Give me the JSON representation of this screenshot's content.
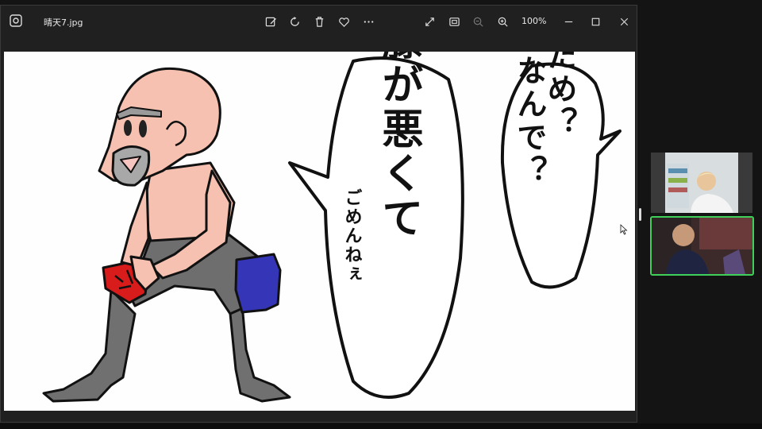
{
  "window": {
    "filename": "晴天7.jpg",
    "zoom_level": "100%",
    "toolbar_icons": [
      "edit-image-icon",
      "rotate-icon",
      "delete-icon",
      "favorite-icon",
      "more-icon"
    ],
    "view_icons": [
      "fullscreen-icon",
      "fit-screen-icon",
      "zoom-out-icon",
      "zoom-in-icon"
    ],
    "window_controls": [
      "minimize-icon",
      "maximize-icon",
      "close-icon"
    ]
  },
  "image": {
    "bubble_right_line1": "だめ？",
    "bubble_right_line2": "なんで？",
    "bubble_center_main": "膝が悪くて",
    "bubble_center_sub": "ごめんねぇ"
  },
  "colors": {
    "window_bg": "#202020",
    "canvas_bg": "#fefefe",
    "active_speaker": "#3fd05a",
    "skin": "#f6c1b0",
    "tights": "#6b6b6b",
    "knee_pad": "#3535b8",
    "knee_pad_left": "#d81b1b"
  },
  "call": {
    "participants": [
      "participant-1",
      "participant-2"
    ],
    "active_speaker_index": 1
  }
}
